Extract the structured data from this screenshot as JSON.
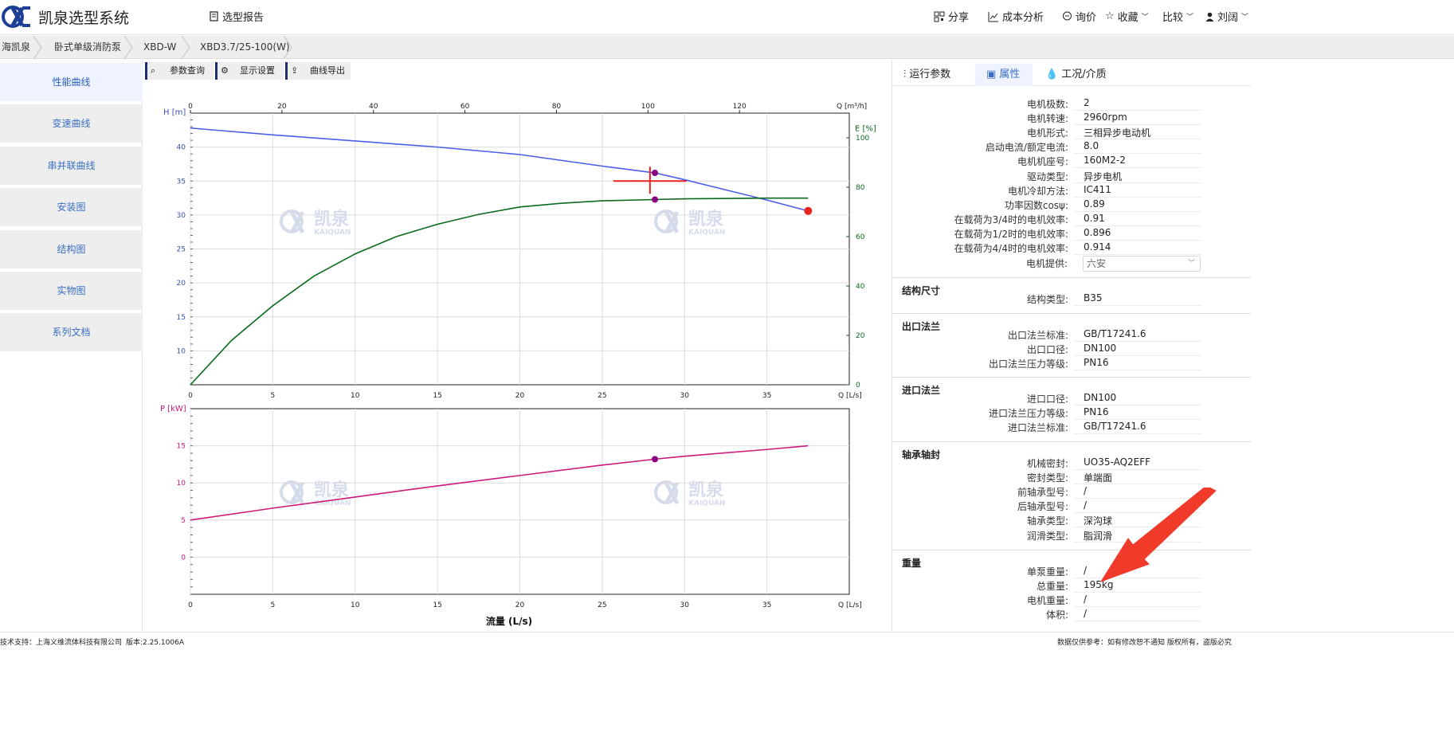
{
  "header": {
    "app_title": "凯泉选型系统",
    "report_label": "选型报告",
    "share_label": "分享",
    "cost_label": "成本分析",
    "inquiry_label": "询价",
    "favorite_label": "收藏",
    "compare_label": "比较",
    "user_label": "刘阔"
  },
  "breadcrumb": {
    "items": [
      "海凯泉",
      "卧式单级消防泵",
      "XBD-W",
      "XBD3.7/25-100(W)"
    ]
  },
  "leftnav": {
    "items": [
      "性能曲线",
      "变速曲线",
      "串并联曲线",
      "安装图",
      "结构图",
      "实物图",
      "系列文档"
    ],
    "active_index": 0
  },
  "toolbar": {
    "query_label": "参数查询",
    "display_label": "显示设置",
    "export_label": "曲线导出"
  },
  "watermark": {
    "brand_cn": "凯泉",
    "brand_en": "KAIQUAN"
  },
  "chart_data": [
    {
      "type": "line",
      "title": "",
      "xlabel": "Q [L/s]",
      "x_top_label": "Q [m³/h]",
      "ylabel": "H [m]",
      "y2label": "E [%]",
      "xlim": [
        0,
        40
      ],
      "ylim": [
        5,
        45
      ],
      "y2lim": [
        0,
        110
      ],
      "x_ticks": [
        0,
        5,
        10,
        15,
        20,
        25,
        30,
        35
      ],
      "x_top_ticks": [
        0,
        20,
        40,
        60,
        80,
        100,
        120
      ],
      "y_ticks": [
        10,
        15,
        20,
        25,
        30,
        35,
        40
      ],
      "y2_ticks": [
        0,
        20,
        40,
        60,
        80,
        100
      ],
      "grid": true,
      "series": [
        {
          "name": "H",
          "color": "#4a5ee8",
          "x": [
            0,
            5,
            10,
            15,
            20,
            25,
            28.2,
            30,
            33,
            35,
            37.5
          ],
          "y": [
            42.8,
            41.8,
            40.9,
            40.0,
            38.9,
            37.2,
            36.2,
            35.2,
            33.4,
            32.2,
            30.6
          ]
        },
        {
          "name": "E",
          "color": "#0a6a1e",
          "axis": "y2",
          "x": [
            0,
            2.5,
            5,
            7.5,
            10,
            12.5,
            15,
            17.5,
            20,
            22.5,
            25,
            28.2,
            30,
            35,
            37.5
          ],
          "y": [
            0,
            18,
            32,
            44,
            53,
            60,
            65,
            69,
            72,
            73.5,
            74.5,
            75,
            75.3,
            75.6,
            75.6
          ]
        }
      ],
      "operating_point": {
        "x": 28.2,
        "H": 36.2,
        "E": 75
      },
      "duty_point": {
        "x": 27.9,
        "H": 35
      },
      "end_point": {
        "x": 37.5,
        "H": 30.6
      }
    },
    {
      "type": "line",
      "title": "",
      "xlabel": "流量 (L/s)",
      "x_axis_label": "Q [L/s]",
      "ylabel": "P [kW]",
      "xlim": [
        0,
        40
      ],
      "ylim": [
        -5,
        20
      ],
      "x_ticks": [
        0,
        5,
        10,
        15,
        20,
        25,
        30,
        35
      ],
      "y_ticks": [
        0,
        5,
        10,
        15
      ],
      "grid": true,
      "series": [
        {
          "name": "P",
          "color": "#cc1a7a",
          "x": [
            0,
            5,
            10,
            15,
            20,
            25,
            28.2,
            30,
            35,
            37.5
          ],
          "y": [
            5.0,
            6.6,
            8.1,
            9.6,
            11.0,
            12.4,
            13.2,
            13.6,
            14.5,
            15.0
          ]
        }
      ],
      "operating_point": {
        "x": 28.2,
        "P": 13.2
      }
    }
  ],
  "rightpanel": {
    "tabs": [
      "运行参数",
      "属性",
      "工况/介质"
    ],
    "active_tab": 1,
    "motor_props": [
      {
        "label": "电机极数:",
        "value": "2"
      },
      {
        "label": "电机转速:",
        "value": "2960rpm"
      },
      {
        "label": "电机形式:",
        "value": "三相异步电动机"
      },
      {
        "label": "启动电流/额定电流:",
        "value": "8.0"
      },
      {
        "label": "电机机座号:",
        "value": "160M2-2"
      },
      {
        "label": "驱动类型:",
        "value": "异步电机"
      },
      {
        "label": "电机冷却方法:",
        "value": "IC411"
      },
      {
        "label": "功率因数cosψ:",
        "value": "0.89"
      },
      {
        "label": "在载荷为3/4时的电机效率:",
        "value": "0.91"
      },
      {
        "label": "在载荷为1/2时的电机效率:",
        "value": "0.896"
      },
      {
        "label": "在载荷为4/4时的电机效率:",
        "value": "0.914"
      }
    ],
    "motor_supply_label": "电机提供:",
    "motor_supply_value": "六安",
    "sections": [
      {
        "title": "结构尺寸",
        "props": [
          {
            "label": "结构类型:",
            "value": "B35"
          }
        ]
      },
      {
        "title": "出口法兰",
        "props": [
          {
            "label": "出口法兰标准:",
            "value": "GB/T17241.6"
          },
          {
            "label": "出口口径:",
            "value": "DN100"
          },
          {
            "label": "出口法兰压力等级:",
            "value": "PN16"
          }
        ]
      },
      {
        "title": "进口法兰",
        "props": [
          {
            "label": "进口口径:",
            "value": "DN100"
          },
          {
            "label": "进口法兰压力等级:",
            "value": "PN16"
          },
          {
            "label": "进口法兰标准:",
            "value": "GB/T17241.6"
          }
        ]
      },
      {
        "title": "轴承轴封",
        "props": [
          {
            "label": "机械密封:",
            "value": "UO35-AQ2EFF"
          },
          {
            "label": "密封类型:",
            "value": "单端面"
          },
          {
            "label": "前轴承型号:",
            "value": "/"
          },
          {
            "label": "后轴承型号:",
            "value": "/"
          },
          {
            "label": "轴承类型:",
            "value": "深沟球"
          },
          {
            "label": "润滑类型:",
            "value": "脂润滑"
          }
        ]
      },
      {
        "title": "重量",
        "props": [
          {
            "label": "单泵重量:",
            "value": "/"
          },
          {
            "label": "总重量:",
            "value": "195kg"
          },
          {
            "label": "电机重量:",
            "value": "/"
          },
          {
            "label": "体积:",
            "value": "/"
          }
        ]
      }
    ]
  },
  "footer": {
    "support": "技术支持：上海义维流体科技有限公司",
    "version": "版本:2.25.1006A",
    "notice": "数据仅供参考：如有修改恕不通知 版权所有，盗版必究"
  },
  "colors": {
    "accent": "#3a6fc4",
    "head_curve": "#4a5ee8",
    "efficiency_curve": "#0a6a1e",
    "power_curve": "#cc1a7a",
    "operating_point": "#8b0080",
    "duty_marker": "#e8231f",
    "annotation_arrow": "#f03a2a"
  }
}
